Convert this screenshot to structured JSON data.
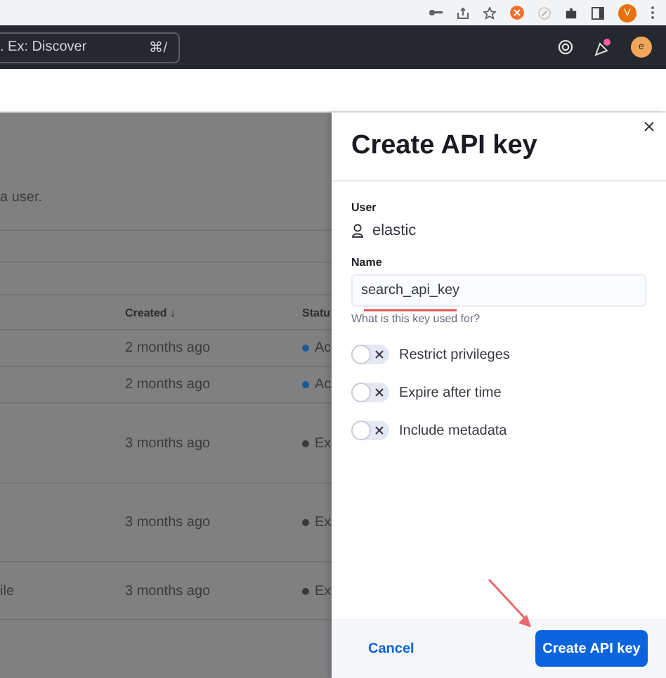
{
  "browser": {
    "profile_initial": "V"
  },
  "header": {
    "search_placeholder": ". Ex: Discover",
    "shortcut": "⌘/",
    "user_initial": "e",
    "news_unread": true
  },
  "page": {
    "description": "a user.",
    "table": {
      "columns": [
        {
          "label": "Created ↓"
        },
        {
          "label": "Statu"
        }
      ],
      "rows": [
        {
          "created": "2 months ago",
          "status": "Ac",
          "color": "#1a5a99"
        },
        {
          "created": "2 months ago",
          "status": "Ac",
          "color": "#1a5a99"
        },
        {
          "created": "3 months ago",
          "status": "Ex",
          "color": "#3a3a3a"
        },
        {
          "created": "3 months ago",
          "status": "Ex",
          "color": "#3a3a3a"
        },
        {
          "name": "ile",
          "created": "3 months ago",
          "status": "Ex",
          "color": "#3a3a3a"
        }
      ]
    }
  },
  "flyout": {
    "title": "Create API key",
    "user_label": "User",
    "user": "elastic",
    "name_label": "Name",
    "name_value": "search_api_key",
    "name_help": "What is this key used for?",
    "toggles": [
      {
        "label": "Restrict privileges",
        "on": false
      },
      {
        "label": "Expire after time",
        "on": false
      },
      {
        "label": "Include metadata",
        "on": false
      }
    ],
    "cancel": "Cancel",
    "submit": "Create API key"
  }
}
